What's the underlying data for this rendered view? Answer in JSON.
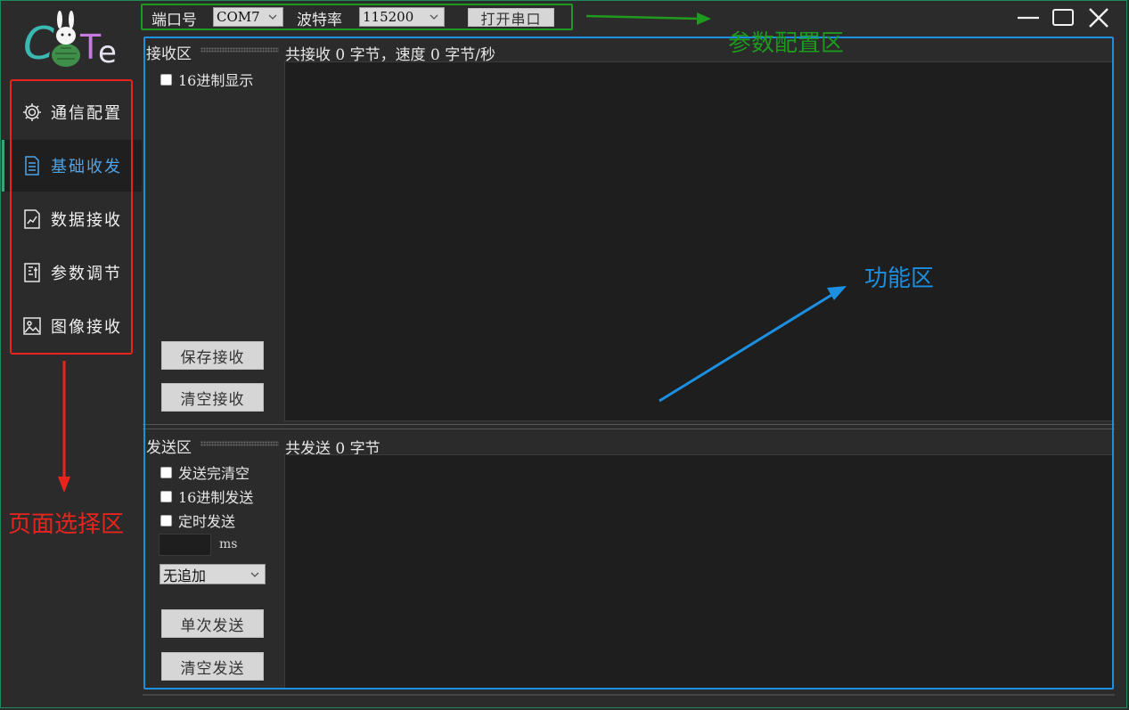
{
  "logo": {
    "text": "CuTe"
  },
  "sidebar": {
    "items": [
      {
        "label": "通信配置",
        "icon": "gear-icon"
      },
      {
        "label": "基础收发",
        "icon": "document-icon"
      },
      {
        "label": "数据接收",
        "icon": "chart-icon"
      },
      {
        "label": "参数调节",
        "icon": "parameter-icon"
      },
      {
        "label": "图像接收",
        "icon": "image-icon"
      }
    ],
    "active_index": 1
  },
  "config": {
    "port_label": "端口号",
    "port_value": "COM7",
    "baud_label": "波特率",
    "baud_value": "115200",
    "open_button": "打开串口"
  },
  "receive": {
    "title": "接收区",
    "stats": "共接收 0 字节，速度 0 字节/秒",
    "hex_display": "16进制显示",
    "save_button": "保存接收",
    "clear_button": "清空接收"
  },
  "send": {
    "title": "发送区",
    "stats": "共发送 0 字节",
    "clear_after_send": "发送完清空",
    "hex_send": "16进制发送",
    "timed_send": "定时发送",
    "interval_value": "",
    "interval_unit": "ms",
    "append_value": "无追加",
    "single_send_button": "单次发送",
    "clear_send_button": "清空发送"
  },
  "annotations": {
    "config_area": "参数配置区",
    "function_area": "功能区",
    "page_select_area": "页面选择区"
  },
  "colors": {
    "background": "#2b2b2b",
    "active_nav_text": "#4fa3e6",
    "annotation_red": "#e8241c",
    "annotation_green": "#1e9a1e",
    "annotation_blue": "#1c8fe0"
  }
}
